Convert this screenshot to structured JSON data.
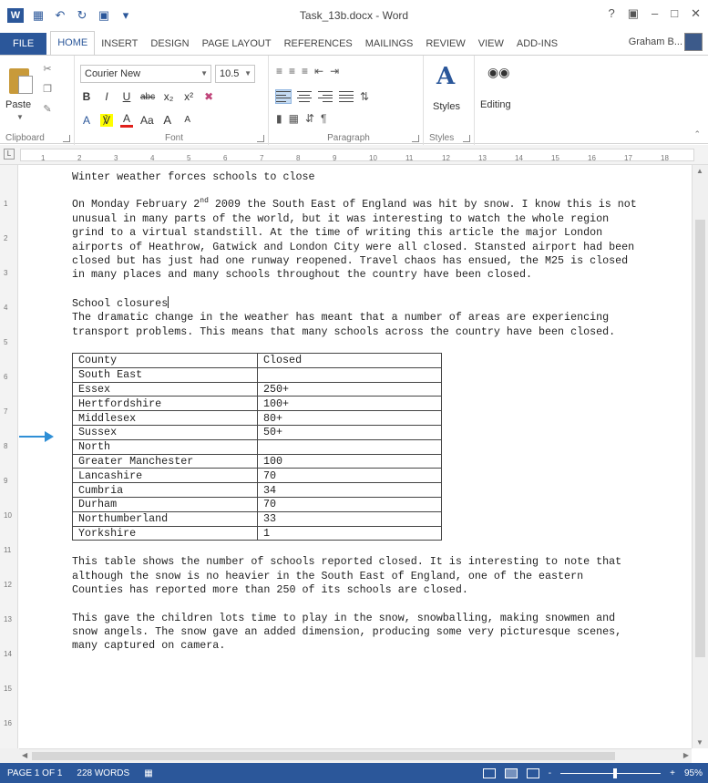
{
  "app": {
    "title": "Task_13b.docx - Word",
    "help": "?",
    "user_name": "Graham B...",
    "colors": {
      "brand": "#2b579a",
      "status_bar": "#2b579a"
    }
  },
  "tabs": [
    "FILE",
    "HOME",
    "INSERT",
    "DESIGN",
    "PAGE LAYOUT",
    "REFERENCES",
    "MAILINGS",
    "REVIEW",
    "VIEW",
    "ADD-INS"
  ],
  "active_tab": "HOME",
  "ribbon": {
    "clipboard": {
      "paste_label": "Paste",
      "group_label": "Clipboard"
    },
    "font": {
      "font_name": "Courier New",
      "font_size": "10.5",
      "group_label": "Font",
      "bold": "B",
      "italic": "I",
      "underline": "U",
      "strike": "abc",
      "subscript": "x₂",
      "superscript": "x²",
      "change_case": "Aa",
      "grow": "A",
      "shrink": "A"
    },
    "paragraph": {
      "group_label": "Paragraph",
      "pilcrow": "¶"
    },
    "styles": {
      "label": "Styles",
      "group_label": "Styles"
    },
    "editing": {
      "label": "Editing"
    }
  },
  "ruler": {
    "marks": [
      "1",
      "2",
      "3",
      "4",
      "5",
      "6",
      "7",
      "8",
      "9",
      "10",
      "11",
      "12",
      "13",
      "14",
      "15",
      "16",
      "17",
      "18"
    ],
    "vmarks": [
      "1",
      "2",
      "3",
      "4",
      "5",
      "6",
      "7",
      "8",
      "9",
      "10",
      "11",
      "12",
      "13",
      "14",
      "15",
      "16"
    ]
  },
  "document": {
    "title_line": "Winter weather forces schools to close",
    "para1_a": "On Monday February 2",
    "para1_sup": "nd",
    "para1_b": " 2009 the South East of England was hit by snow. I know this is not unusual in many parts of the world, but it was interesting to watch the whole region grind to a virtual standstill. At the time of writing this article the major London airports of Heathrow, Gatwick and London City were all closed. Stansted airport had been closed but has just had one runway reopened. Travel chaos has ensued, the M25 is closed in many places and many schools throughout the country have been closed.",
    "section_heading": "School closures",
    "para2": "The dramatic change in the weather has meant that a number of areas are experiencing transport problems. This means that many schools across the country have been closed.",
    "table": {
      "headers": [
        "County",
        "Closed"
      ],
      "rows": [
        [
          "South East",
          ""
        ],
        [
          "Essex",
          "250+"
        ],
        [
          "Hertfordshire",
          "100+"
        ],
        [
          "Middlesex",
          "80+"
        ],
        [
          "Sussex",
          "50+"
        ],
        [
          "North",
          ""
        ],
        [
          "Greater Manchester",
          "100"
        ],
        [
          "Lancashire",
          "70"
        ],
        [
          "Cumbria",
          "34"
        ],
        [
          "Durham",
          "70"
        ],
        [
          "Northumberland",
          "33"
        ],
        [
          "Yorkshire",
          "1"
        ]
      ]
    },
    "para3": "This table shows the number of schools reported closed. It is interesting to note that although the snow is no heavier in the South East of England, one of the eastern Counties has reported more than 250 of its schools are closed.",
    "para4": "This gave the children lots time to play in the snow, snowballing, making snowmen and snow angels. The snow gave an added dimension, producing some very picturesque scenes, many captured on camera."
  },
  "status": {
    "page": "PAGE 1 OF 1",
    "words": "228 WORDS",
    "zoom": "95%",
    "zoom_minus": "-",
    "zoom_plus": "+",
    "zoom_level": 0.55
  }
}
